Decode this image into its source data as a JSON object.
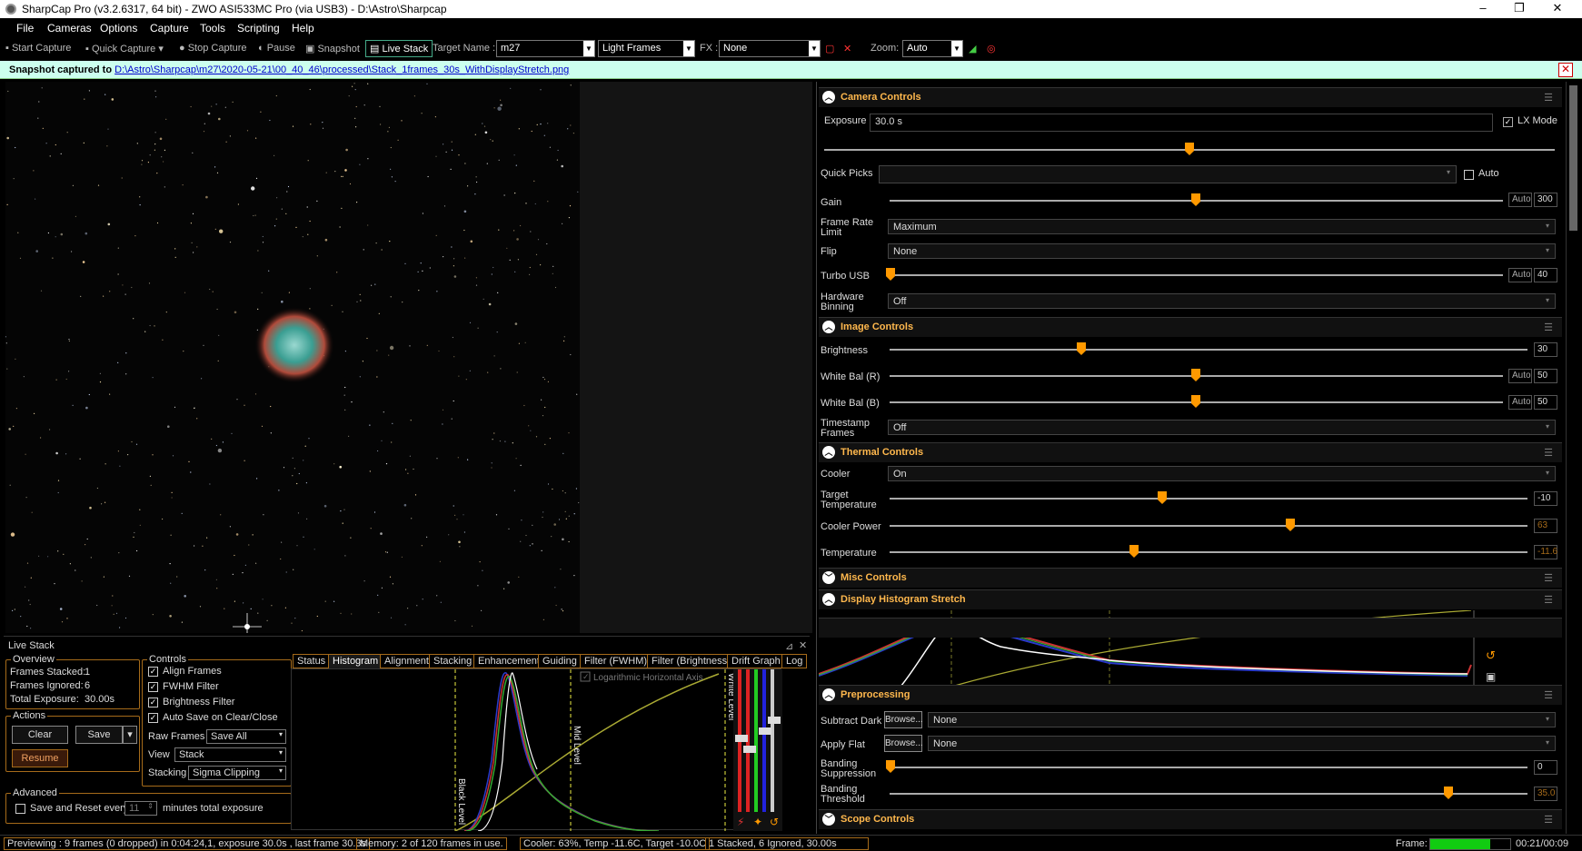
{
  "title": "SharpCap Pro (v3.2.6317, 64 bit) - ZWO ASI533MC Pro (via USB3) - D:\\Astro\\Sharpcap",
  "window": {
    "min": "–",
    "max": "❐",
    "close": "✕"
  },
  "menu": [
    "File",
    "Cameras",
    "Options",
    "Capture",
    "Tools",
    "Scripting",
    "Help"
  ],
  "toolbar": {
    "start_capture": "Start Capture",
    "quick_capture": "Quick Capture",
    "stop_capture": "Stop Capture",
    "pause": "Pause",
    "snapshot": "Snapshot",
    "live_stack": "Live Stack",
    "target_label": "Target Name :",
    "target_value": "m27",
    "frame_type": "Light Frames",
    "fx_label": "FX :",
    "fx_value": "None",
    "zoom_label": "Zoom:",
    "zoom_value": "Auto"
  },
  "notification": {
    "prefix": "Snapshot captured to",
    "path": "D:\\Astro\\Sharpcap\\m27\\2020-05-21\\00_40_46\\processed\\Stack_1frames_30s_WithDisplayStretch.png",
    "close": "✕"
  },
  "livestack": {
    "title": "Live Stack",
    "pin": "⊿",
    "close": "✕",
    "overview_label": "Overview",
    "frames_stacked": "Frames Stacked:",
    "frames_stacked_val": "1",
    "frames_ignored": "Frames Ignored:",
    "frames_ignored_val": "6",
    "total_exposure": "Total Exposure:",
    "total_exposure_val": "30.00s",
    "actions_label": "Actions",
    "clear": "Clear",
    "save": "Save",
    "save_dd": "▾",
    "resume": "Resume",
    "advanced_label": "Advanced",
    "save_reset": "Save and Reset every",
    "save_reset_val": "11",
    "minutes_total": "minutes total exposure",
    "controls_label": "Controls",
    "align_frames": "Align Frames",
    "fwhm_filter": "FWHM Filter",
    "brightness_filter": "Brightness Filter",
    "autosave": "Auto Save on Clear/Close",
    "raw_frames_label": "Raw Frames",
    "raw_frames_val": "Save All",
    "view_label": "View",
    "view_val": "Stack",
    "stacking_label": "Stacking",
    "stacking_val": "Sigma Clipping",
    "check": "✓",
    "tabs": [
      "Status",
      "Histogram",
      "Alignment",
      "Stacking",
      "Enhancement",
      "Guiding",
      "Filter (FWHM)",
      "Filter (Brightness)",
      "Drift Graph",
      "Log"
    ],
    "log_axis": "Logarithmic Horizontal Axis",
    "black_level": "Black Level",
    "mid_level": "Mid Level",
    "white_level": "White Level"
  },
  "status": {
    "previewing": "Previewing : 9 frames (0 dropped) in 0:04:24,1, exposure 30.0s , last frame 30.3s",
    "memory": "Memory: 2 of 120 frames in use.",
    "cooler": "Cooler: 63%, Temp -11.6C, Target -10.0C",
    "stacked": "1 Stacked, 6 Ignored, 30.00s",
    "frame_label": "Frame:",
    "frame_time": "00:21/00:09",
    "frame_progress": 0.75
  },
  "camera_controls": {
    "title": "Camera Controls",
    "exposure_label": "Exposure",
    "exposure_val": "30.0 s",
    "lx_mode": "LX Mode",
    "quick_picks": "Quick Picks",
    "auto": "Auto",
    "gain": "Gain",
    "gain_val": "300",
    "frame_rate": "Frame Rate Limit",
    "frame_rate_val": "Maximum",
    "flip": "Flip",
    "flip_val": "None",
    "turbo_usb": "Turbo USB",
    "turbo_val": "40",
    "hw_binning": "Hardware Binning",
    "hw_binning_val": "Off"
  },
  "image_controls": {
    "title": "Image Controls",
    "brightness": "Brightness",
    "brightness_val": "30",
    "wb_r": "White Bal (R)",
    "wb_r_val": "50",
    "wb_b": "White Bal (B)",
    "wb_b_val": "50",
    "timestamp": "Timestamp Frames",
    "timestamp_val": "Off"
  },
  "thermal_controls": {
    "title": "Thermal Controls",
    "cooler": "Cooler",
    "cooler_val": "On",
    "target_temp": "Target Temperature",
    "target_temp_val": "-10",
    "cooler_power": "Cooler Power",
    "cooler_power_val": "63",
    "temperature": "Temperature",
    "temperature_val": "-11.6"
  },
  "misc_controls": {
    "title": "Misc Controls"
  },
  "display_histogram": {
    "title": "Display Histogram Stretch"
  },
  "preprocessing": {
    "title": "Preprocessing",
    "subtract_dark": "Subtract Dark",
    "apply_flat": "Apply Flat",
    "browse": "Browse...",
    "none": "None",
    "banding_suppression": "Banding Suppression",
    "banding_suppression_val": "0",
    "banding_threshold": "Banding Threshold",
    "banding_threshold_val": "35.0"
  },
  "scope_controls": {
    "title": "Scope Controls"
  },
  "colors": {
    "accent": "#ff9900",
    "section_title": "#ffb84d",
    "border": "#a66b1a",
    "notify_bg": "#ccffee"
  }
}
